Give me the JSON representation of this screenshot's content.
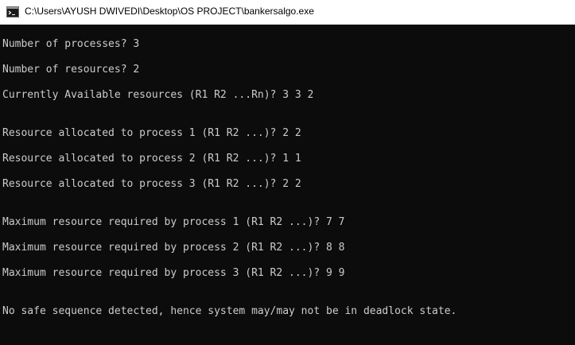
{
  "window": {
    "title": "C:\\Users\\AYUSH DWIVEDI\\Desktop\\OS PROJECT\\bankersalgo.exe",
    "icon": "console-app-icon"
  },
  "console": {
    "lines": [
      "Number of processes? 3",
      "Number of resources? 2",
      "Currently Available resources (R1 R2 ...Rn)? 3 3 2",
      "Resource allocated to process 1 (R1 R2 ...)? 2 2",
      "Resource allocated to process 2 (R1 R2 ...)? 1 1",
      "Resource allocated to process 3 (R1 R2 ...)? 2 2",
      "Maximum resource required by process 1 (R1 R2 ...)? 7 7",
      "Maximum resource required by process 2 (R1 R2 ...)? 8 8",
      "Maximum resource required by process 3 (R1 R2 ...)? 9 9",
      "No safe sequence detected, hence system may/may not be in deadlock state."
    ]
  },
  "colors": {
    "console_background": "#0c0c0c",
    "console_text": "#cccccc",
    "titlebar_background": "#ffffff"
  }
}
